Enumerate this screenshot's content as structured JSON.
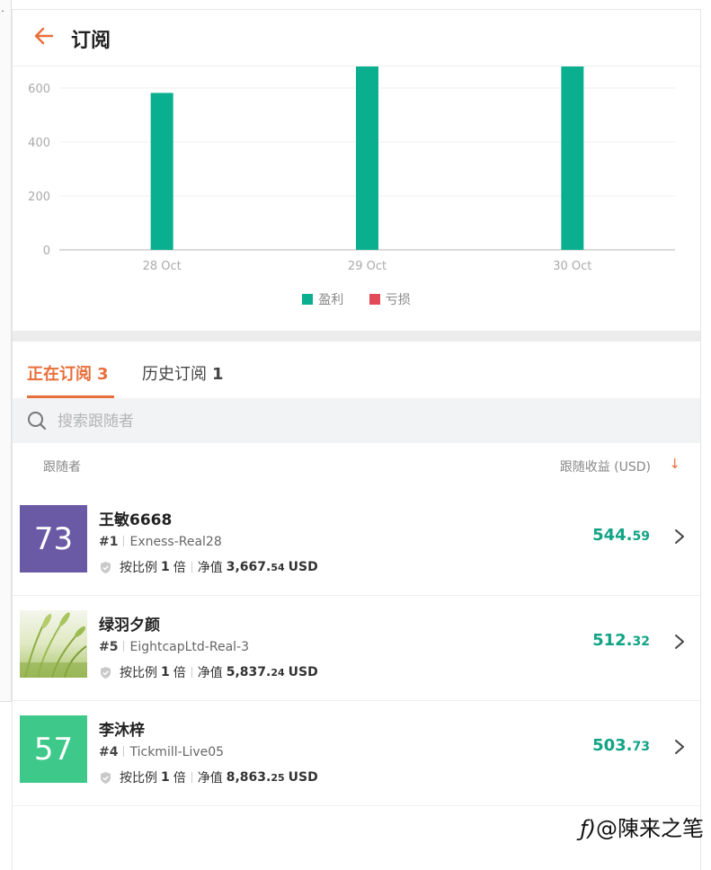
{
  "header": {
    "title": "订阅"
  },
  "colors": {
    "accent": "#e86f3a",
    "profit": "#12a385",
    "loss": "#e34a59",
    "bar": "#0aaf8f"
  },
  "chart_data": {
    "type": "bar",
    "categories": [
      "28 Oct",
      "29 Oct",
      "30 Oct"
    ],
    "series": [
      {
        "name": "盈利",
        "values": [
          582,
          700,
          700
        ]
      },
      {
        "name": "亏损",
        "values": [
          0,
          0,
          0
        ]
      }
    ],
    "yticks": [
      0,
      200,
      400,
      600
    ],
    "ytick_labels": [
      "0",
      "200",
      "400",
      "600"
    ],
    "ylim": [
      0,
      680
    ],
    "legend": [
      "盈利",
      "亏损"
    ],
    "legend_position": "bottom",
    "grid": true
  },
  "tabs": [
    {
      "label": "正在订阅",
      "count": "3"
    },
    {
      "label": "历史订阅",
      "count": "1"
    }
  ],
  "search": {
    "placeholder": "搜索跟随者"
  },
  "columns": {
    "follower": "跟随者",
    "profit": "跟随收益 (USD)",
    "sort_icon": "arrow-down-icon"
  },
  "followers": [
    {
      "avatar_text": "73",
      "avatar_color": "#6a5aa6",
      "name": "王敏6668",
      "rank": "#1",
      "account": "Exness-Real28",
      "ratio_label": "按比例",
      "ratio_value": "1",
      "ratio_unit": "倍",
      "equity_label": "净值",
      "equity_int": "3,667.",
      "equity_dec": "54",
      "equity_unit": "USD",
      "profit_int": "544.",
      "profit_dec": "59"
    },
    {
      "avatar_text": "",
      "avatar_image": "wheat-field",
      "name": "绿羽夕颜",
      "rank": "#5",
      "account": "EightcapLtd-Real-3",
      "ratio_label": "按比例",
      "ratio_value": "1",
      "ratio_unit": "倍",
      "equity_label": "净值",
      "equity_int": "5,837.",
      "equity_dec": "24",
      "equity_unit": "USD",
      "profit_int": "512.",
      "profit_dec": "32"
    },
    {
      "avatar_text": "57",
      "avatar_color": "#3ec98a",
      "name": "李沐梓",
      "rank": "#4",
      "account": "Tickmill-Live05",
      "ratio_label": "按比例",
      "ratio_value": "1",
      "ratio_unit": "倍",
      "equity_label": "净值",
      "equity_int": "8,863.",
      "equity_dec": "25",
      "equity_unit": "USD",
      "profit_int": "503.",
      "profit_dec": "73"
    }
  ],
  "watermark": "@陳来之笔"
}
